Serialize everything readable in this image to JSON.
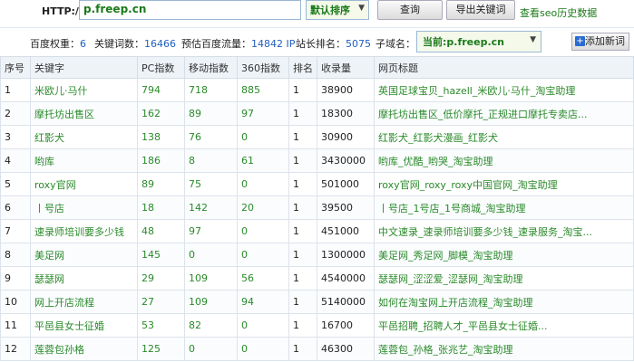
{
  "toolbar": {
    "http_label": "HTTP://",
    "url_value": "p.freep.cn",
    "sort_label": "默认排序",
    "query_label": "查询",
    "export_label": "导出关键词",
    "history_label": "查看seo历史数据"
  },
  "stats": {
    "baidu_weight_label": "百度权重：",
    "baidu_weight_value": "6",
    "keywords_label": "关键词数：",
    "keywords_value": "16466",
    "traffic_label": "预估百度流量：",
    "traffic_value": "14842 IP",
    "rank_label": "站长排名：",
    "rank_value": "5075",
    "subdomain_label": "子域名：",
    "subdomain_value": "当前:p.freep.cn",
    "add_label": "添加新词"
  },
  "table": {
    "headers": [
      "序号",
      "关键字",
      "PC指数",
      "移动指数",
      "360指数",
      "排名",
      "收录量",
      "网页标题"
    ],
    "rows": [
      {
        "idx": "1",
        "kw": "米欧儿·马什",
        "pc": "794",
        "mobile": "718",
        "s360": "885",
        "rank": "1",
        "indexed": "38900",
        "title": "英国足球宝贝_hazell_米欧儿·马什_淘宝助理"
      },
      {
        "idx": "2",
        "kw": "摩托坊出售区",
        "pc": "162",
        "mobile": "89",
        "s360": "97",
        "rank": "1",
        "indexed": "18300",
        "title": "摩托坊出售区_低价摩托_正规进口摩托专卖店..."
      },
      {
        "idx": "3",
        "kw": "红影犬",
        "pc": "138",
        "mobile": "76",
        "s360": "0",
        "rank": "1",
        "indexed": "30900",
        "title": "红影犬_红影犬漫画_红影犬"
      },
      {
        "idx": "4",
        "kw": "哟库",
        "pc": "186",
        "mobile": "8",
        "s360": "61",
        "rank": "1",
        "indexed": "3430000",
        "title": "哟库_优酷_哟哭_淘宝助理"
      },
      {
        "idx": "5",
        "kw": "roxy官网",
        "pc": "89",
        "mobile": "75",
        "s360": "0",
        "rank": "1",
        "indexed": "501000",
        "title": "roxy官网_roxy_roxy中国官网_淘宝助理"
      },
      {
        "idx": "6",
        "kw": "丨号店",
        "pc": "18",
        "mobile": "142",
        "s360": "20",
        "rank": "1",
        "indexed": "39500",
        "title": "丨号店_1号店_1号商城_淘宝助理"
      },
      {
        "idx": "7",
        "kw": "速录师培训要多少钱",
        "pc": "48",
        "mobile": "97",
        "s360": "0",
        "rank": "1",
        "indexed": "451000",
        "title": "中文速录_速录师培训要多少钱_速录服务_淘宝..."
      },
      {
        "idx": "8",
        "kw": "美足网",
        "pc": "145",
        "mobile": "0",
        "s360": "0",
        "rank": "1",
        "indexed": "1300000",
        "title": "美足网_秀足网_脚模_淘宝助理"
      },
      {
        "idx": "9",
        "kw": "瑟瑟网",
        "pc": "29",
        "mobile": "109",
        "s360": "56",
        "rank": "1",
        "indexed": "4540000",
        "title": "瑟瑟网_涩涩爱_涩瑟网_淘宝助理"
      },
      {
        "idx": "10",
        "kw": "网上开店流程",
        "pc": "27",
        "mobile": "109",
        "s360": "94",
        "rank": "1",
        "indexed": "5140000",
        "title": "如何在淘宝网上开店流程_淘宝助理"
      },
      {
        "idx": "11",
        "kw": "平邑县女士征婚",
        "pc": "53",
        "mobile": "82",
        "s360": "0",
        "rank": "1",
        "indexed": "16700",
        "title": "平邑招聘_招聘人才_平邑县女士征婚..."
      },
      {
        "idx": "12",
        "kw": "莲蓉包孙格",
        "pc": "125",
        "mobile": "0",
        "s360": "0",
        "rank": "1",
        "indexed": "46300",
        "title": "莲蓉包_孙格_张兆艺_淘宝助理"
      }
    ]
  },
  "colors": {
    "accent_green": "#2a8a2a",
    "highlight_red": "#d42020",
    "link_blue": "#1f5fbf"
  },
  "icons": {
    "add": "plus-icon",
    "dropdown": "chevron-down-icon"
  }
}
